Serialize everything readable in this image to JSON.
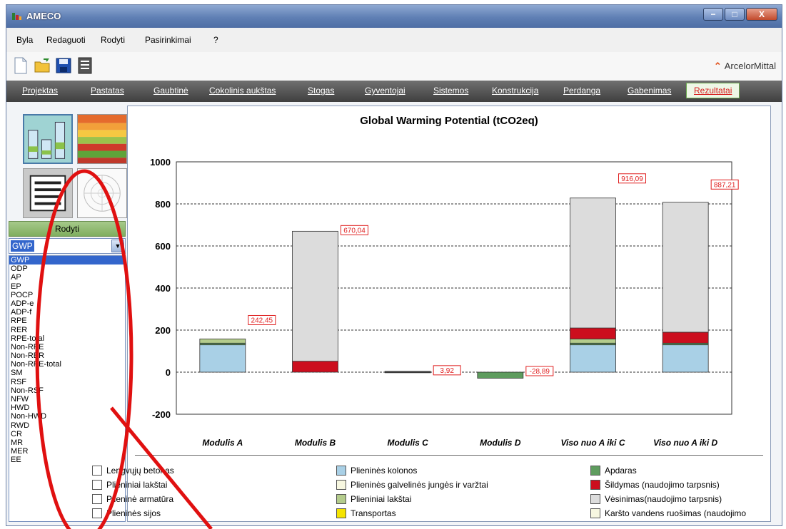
{
  "window": {
    "title": "AMECO",
    "minimize": "−",
    "maximize": "□",
    "close": "X"
  },
  "menu": [
    "Byla",
    "Redaguoti",
    "Rodyti",
    "Pasirinkimai",
    "?"
  ],
  "toolbar": {
    "buttons": [
      "new-icon",
      "open-icon",
      "save-icon",
      "report-icon"
    ],
    "brand": "ArcelorMittal"
  },
  "tabs": [
    "Projektas",
    "Pastatas",
    "Gaubtinė",
    "Cokolinis aukštas",
    "Stogas",
    "Gyventojai",
    "Sistemos",
    "Konstrukcija",
    "Perdanga",
    "Gabenimas",
    "Rezultatai"
  ],
  "active_tab": "Rezultatai",
  "left_panel": {
    "thumbnails": [
      "bar-chart-view-icon",
      "table-color-view-icon",
      "document-view-icon",
      "radar-view-icon"
    ],
    "rodyti_label": "Rodyti",
    "selected_indicator": "GWP",
    "indicators": [
      "GWP",
      "ODP",
      "AP",
      "EP",
      "POCP",
      "ADP-e",
      "ADP-f",
      "RPE",
      "RER",
      "RPE-total",
      "Non-RPE",
      "Non-RER",
      "Non-RPE-total",
      "SM",
      "RSF",
      "Non-RSF",
      "NFW",
      "HWD",
      "Non-HWD",
      "RWD",
      "CR",
      "MR",
      "MER",
      "EE"
    ]
  },
  "chart_data": {
    "type": "bar",
    "stacked": true,
    "title": "Global Warming Potential (tCO2eq)",
    "ylim": [
      -200,
      1000
    ],
    "yticks": [
      1000,
      800,
      600,
      400,
      200,
      0,
      -200
    ],
    "grid": true,
    "categories": [
      "Modulis A",
      "Modulis B",
      "Modulis C",
      "Modulis D",
      "Viso nuo A iki C",
      "Viso nuo A iki D"
    ],
    "totals": [
      "242,45",
      "670,04",
      "3,92",
      "-28,89",
      "916,09",
      "887,21"
    ],
    "series": [
      {
        "name": "Plieninės kolonos",
        "color": "#a9d0e6",
        "values": [
          130,
          0,
          0,
          0,
          130,
          130
        ]
      },
      {
        "name": "Apdaras",
        "color": "#5e9c5e",
        "values": [
          8,
          0,
          0,
          0,
          8,
          8
        ]
      },
      {
        "name": "Plieniniai lakštai",
        "color": "#b4cc8c",
        "values": [
          20,
          0,
          0,
          0,
          20,
          0
        ]
      },
      {
        "name": "Šildymas (naudojimo tarpsnis)",
        "color": "#cc0e1e",
        "values": [
          0,
          52,
          0,
          0,
          52,
          52
        ]
      },
      {
        "name": "Vėsinimas(naudojimo tarpsnis)",
        "color": "#dcdcdc",
        "values": [
          0,
          618,
          0,
          0,
          618,
          618
        ]
      }
    ],
    "legend": [
      {
        "label": "Lengvųjų betonas",
        "color": "#ffffff"
      },
      {
        "label": "Plieniniai lakštai",
        "color": "#ffffff"
      },
      {
        "label": "Plieninė armatūra",
        "color": "#ffffff"
      },
      {
        "label": "Plieninės sijos",
        "color": "#ffffff"
      },
      {
        "label": "Plieninės kolonos",
        "color": "#a9d0e6"
      },
      {
        "label": "Plieninės galvelinės jungės ir varžtai",
        "color": "#f7f7e0"
      },
      {
        "label": "Plieniniai lakštai",
        "color": "#b4cc8c"
      },
      {
        "label": "Transportas",
        "color": "#f5e400"
      },
      {
        "label": "Apdaras",
        "color": "#5e9c5e"
      },
      {
        "label": "Šildymas (naudojimo tarpsnis)",
        "color": "#cc0e1e"
      },
      {
        "label": "Vėsinimas(naudojimo tarpsnis)",
        "color": "#dcdcdc"
      },
      {
        "label": "Karšto vandens ruošimas (naudojimo",
        "color": "#f7f7e0"
      }
    ]
  }
}
